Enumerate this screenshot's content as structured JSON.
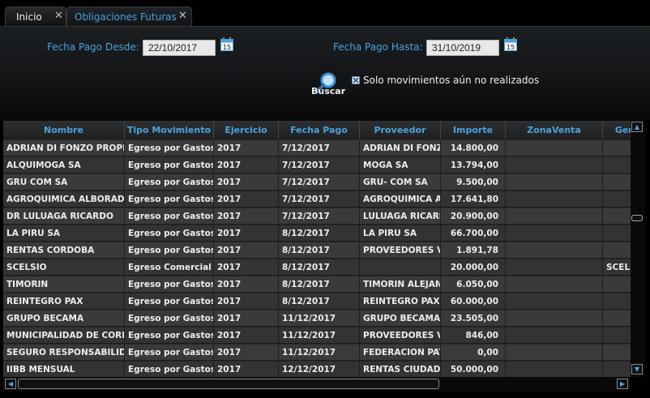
{
  "tabs": [
    {
      "label": "Inicio",
      "close": "✕"
    },
    {
      "label": "Obligaciones Futuras",
      "close": "✕"
    }
  ],
  "form": {
    "desde_label": "Fecha Pago Desde:",
    "desde_value": "22/10/2017",
    "hasta_label": "Fecha Pago Hasta:",
    "hasta_value": "31/10/2019",
    "calendar_text": "15",
    "search_label": "Buscar",
    "checkbox_label": "Solo movimientos aún no realizados",
    "checkbox_checked": true
  },
  "grid": {
    "columns": [
      "Nombre",
      "Tipo Movimiento",
      "Ejercicio",
      "Fecha Pago",
      "Proveedor",
      "Importe",
      "ZonaVenta",
      "Gere"
    ],
    "rows": [
      [
        "ADRIAN DI FONZO PROPIEI",
        "Egreso por Gastos",
        "2017",
        "7/12/2017",
        "ADRIAN DI FONZO",
        "14.800,00",
        "",
        ""
      ],
      [
        "ALQUIMOGA SA",
        "Egreso por Gastos",
        "2017",
        "7/12/2017",
        "MOGA SA",
        "13.794,00",
        "",
        ""
      ],
      [
        "GRU COM SA",
        "Egreso por Gastos",
        "2017",
        "7/12/2017",
        "GRU- COM SA",
        "9.500,00",
        "",
        ""
      ],
      [
        "AGROQUIMICA ALBORADA S",
        "Egreso por Gastos",
        "2017",
        "7/12/2017",
        "AGROQUIMICA AL",
        "17.641,80",
        "",
        ""
      ],
      [
        "DR LULUAGA RICARDO",
        "Egreso por Gastos",
        "2017",
        "7/12/2017",
        "LULUAGA RICARD",
        "20.900,00",
        "",
        ""
      ],
      [
        "LA PIRU SA",
        "Egreso por Gastos",
        "2017",
        "8/12/2017",
        "LA PIRU SA",
        "66.700,00",
        "",
        ""
      ],
      [
        "RENTAS CORDOBA",
        "Egreso por Gastos",
        "2017",
        "8/12/2017",
        "PROVEEDORES VA",
        "1.891,78",
        "",
        ""
      ],
      [
        "SCELSIO",
        "Egreso Comercial",
        "2017",
        "8/12/2017",
        "",
        "20.000,00",
        "",
        "SCELS"
      ],
      [
        "TIMORIN",
        "Egreso por Gastos",
        "2017",
        "8/12/2017",
        "TIMORIN ALEJANI",
        "6.050,00",
        "",
        ""
      ],
      [
        "REINTEGRO PAX",
        "Egreso por Gastos",
        "2017",
        "8/12/2017",
        "REINTEGRO PAX",
        "60.000,00",
        "",
        ""
      ],
      [
        "GRUPO BECAMA",
        "Egreso por Gastos",
        "2017",
        "11/12/2017",
        "GRUPO BECAMA S",
        "23.505,00",
        "",
        ""
      ],
      [
        "MUNICIPALIDAD DE CORDO",
        "Egreso por Gastos",
        "2017",
        "11/12/2017",
        "PROVEEDORES VA",
        "846,00",
        "",
        ""
      ],
      [
        "SEGURO RESPONSABILIDAI",
        "Egreso por Gastos",
        "2017",
        "11/12/2017",
        "FEDERACION PAT",
        "0,00",
        "",
        ""
      ],
      [
        "IIBB MENSUAL",
        "Egreso por Gastos",
        "2017",
        "12/12/2017",
        "RENTAS CIUDAD",
        "50.000,00",
        "",
        ""
      ]
    ]
  },
  "colors": {
    "accent": "#4aa3df",
    "background": "#000000",
    "row": "#3a3a3a"
  },
  "icons": {
    "calendar": "calendar-icon",
    "search": "magnifier-icon",
    "close": "close-icon"
  }
}
